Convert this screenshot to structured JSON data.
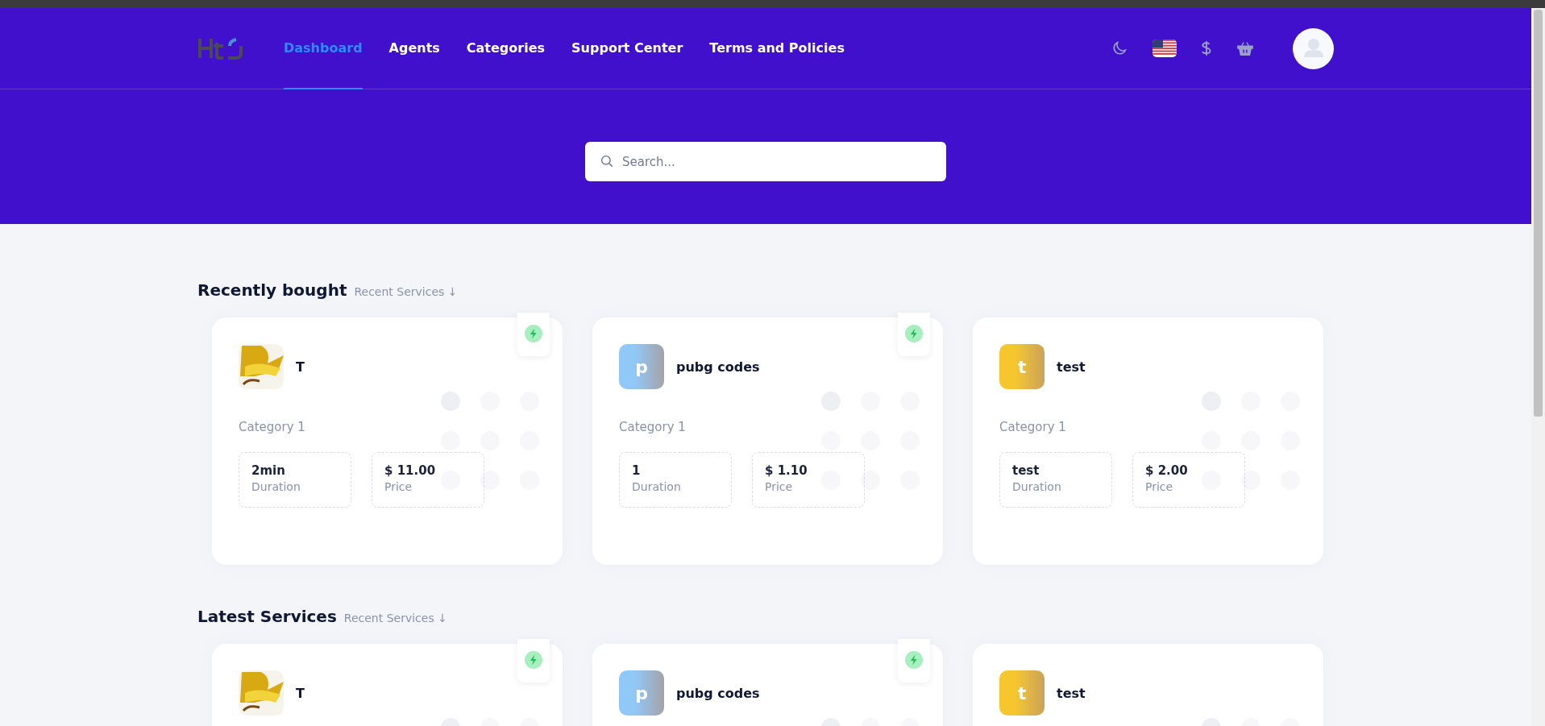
{
  "nav": {
    "items": [
      {
        "label": "Dashboard",
        "selected": true
      },
      {
        "label": "Agents",
        "selected": false
      },
      {
        "label": "Categories",
        "selected": false
      },
      {
        "label": "Support Center",
        "selected": false
      },
      {
        "label": "Terms and Policies",
        "selected": false
      }
    ]
  },
  "search": {
    "placeholder": "Search..."
  },
  "sections": [
    {
      "title": "Recently bought",
      "link": "Recent Services ↓",
      "cards": [
        {
          "kind": "image",
          "name": "T",
          "instant": true,
          "category": "Category 1",
          "duration": "2min",
          "duration_label": "Duration",
          "price": "$ 11.00",
          "price_label": "Price"
        },
        {
          "kind": "letter",
          "letter": "p",
          "color": "#90c8f8",
          "name": "pubg codes",
          "instant": true,
          "category": "Category 1",
          "duration": "1",
          "duration_label": "Duration",
          "price": "$ 1.10",
          "price_label": "Price"
        },
        {
          "kind": "letter",
          "letter": "t",
          "color": "#f5c62e",
          "name": "test",
          "instant": false,
          "category": "Category 1",
          "duration": "test",
          "duration_label": "Duration",
          "price": "$ 2.00",
          "price_label": "Price"
        }
      ]
    },
    {
      "title": "Latest Services",
      "link": "Recent Services ↓",
      "cards": [
        {
          "kind": "image",
          "name": "T",
          "instant": true
        },
        {
          "kind": "letter",
          "letter": "p",
          "color": "#90c8f8",
          "name": "pubg codes",
          "instant": true
        },
        {
          "kind": "letter",
          "letter": "t",
          "color": "#f5c62e",
          "name": "test",
          "instant": false
        }
      ]
    }
  ]
}
